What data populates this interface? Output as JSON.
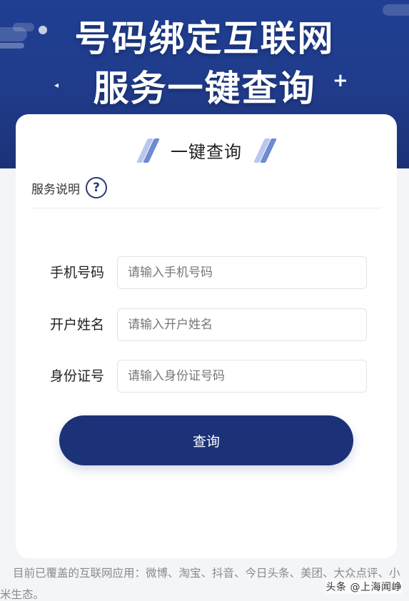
{
  "banner": {
    "title_line1": "号码绑定互联网",
    "title_line2": "服务一键查询"
  },
  "card": {
    "title": "一键查询",
    "service_label": "服务说明",
    "help_symbol": "?"
  },
  "form": {
    "phone": {
      "label": "手机号码",
      "placeholder": "请输入手机号码",
      "value": ""
    },
    "name": {
      "label": "开户姓名",
      "placeholder": "请输入开户姓名",
      "value": ""
    },
    "id": {
      "label": "身份证号",
      "placeholder": "请输入身份证号码",
      "value": ""
    }
  },
  "query_button_label": "查询",
  "footer": {
    "text": "目前已覆盖的互联网应用：微博、淘宝、抖音、今日头条、美团、大众点评、小米生态。"
  },
  "watermark": "头条 @上海闻峥",
  "colors": {
    "banner": "#1f3f93",
    "button": "#1b3278",
    "accent": "#2b3a78"
  }
}
